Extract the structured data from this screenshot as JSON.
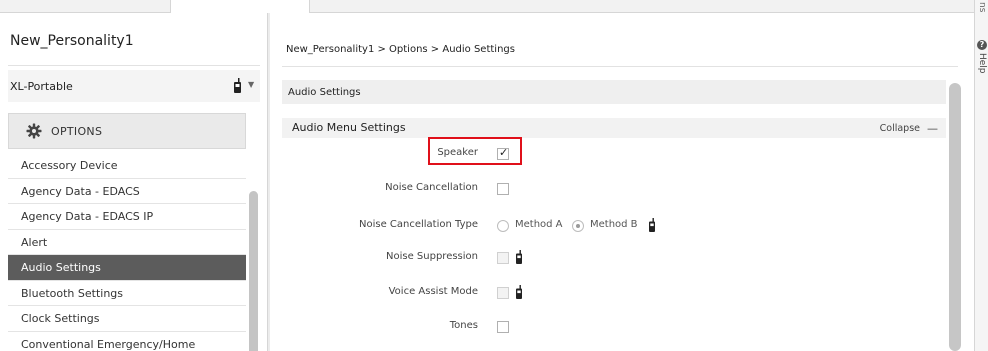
{
  "personality": {
    "name": "New_Personality1",
    "device": "XL-Portable",
    "device_icon": "radio-handheld-icon"
  },
  "options": {
    "header": "OPTIONS",
    "items": [
      {
        "label": "Accessory Device"
      },
      {
        "label": "Agency Data - EDACS"
      },
      {
        "label": "Agency Data - EDACS IP"
      },
      {
        "label": "Alert"
      },
      {
        "label": "Audio Settings",
        "active": true
      },
      {
        "label": "Bluetooth Settings"
      },
      {
        "label": "Clock Settings"
      },
      {
        "label": "Conventional Emergency/Home"
      }
    ]
  },
  "main": {
    "breadcrumb": "New_Personality1 > Options > Audio Settings",
    "section_title": "Audio Settings",
    "subsection_title": "Audio Menu Settings",
    "collapse_label": "Collapse",
    "collapse_symbol": "—",
    "fields": {
      "speaker": {
        "label": "Speaker",
        "checked": true
      },
      "noise_cancellation": {
        "label": "Noise Cancellation",
        "checked": false
      },
      "noise_cancellation_type": {
        "label": "Noise Cancellation Type",
        "options": [
          "Method A",
          "Method B"
        ],
        "selected": "Method B"
      },
      "noise_suppression": {
        "label": "Noise Suppression",
        "checked": false
      },
      "voice_assist_mode": {
        "label": "Voice Assist Mode",
        "checked": false
      },
      "tones": {
        "label": "Tones",
        "checked": false
      }
    }
  },
  "right_edge": {
    "top_text": "ns",
    "help_label": "Help"
  },
  "colors": {
    "highlight": "#e0101a",
    "active_item_bg": "#5c5c5c"
  }
}
